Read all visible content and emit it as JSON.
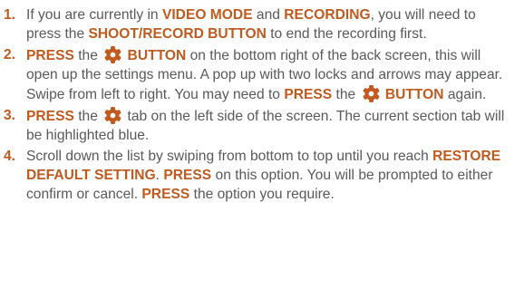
{
  "instructions": [
    {
      "number": "1.",
      "parts": [
        {
          "t": "If you are currently in ",
          "b": false
        },
        {
          "t": "VIDEO MODE",
          "b": true
        },
        {
          "t": " and ",
          "b": false
        },
        {
          "t": "RECORDING",
          "b": true
        },
        {
          "t": ", you will need to press the ",
          "b": false
        },
        {
          "t": "SHOOT/RECORD BUTTON",
          "b": true
        },
        {
          "t": " to end the recording first.",
          "b": false
        }
      ]
    },
    {
      "number": "2.",
      "parts": [
        {
          "t": "PRESS",
          "b": true
        },
        {
          "t": " the ",
          "b": false
        },
        {
          "icon": "gear-icon"
        },
        {
          "t": " BUTTON",
          "b": true
        },
        {
          "t": " on the bottom right of the back screen, this will open up the settings menu. A pop up with two locks and arrows may appear. Swipe from left to right. You may need to ",
          "b": false
        },
        {
          "t": "PRESS",
          "b": true
        },
        {
          "t": " the ",
          "b": false
        },
        {
          "icon": "gear-icon"
        },
        {
          "t": " BUTTON",
          "b": true
        },
        {
          "t": " again.",
          "b": false
        }
      ]
    },
    {
      "number": "3.",
      "parts": [
        {
          "t": "PRESS",
          "b": true
        },
        {
          "t": " the ",
          "b": false
        },
        {
          "icon": "gear-icon"
        },
        {
          "t": " tab on the left side of the screen. The current section tab will be highlighted blue.",
          "b": false
        }
      ]
    },
    {
      "number": "4.",
      "parts": [
        {
          "t": "Scroll down the list by swiping from bottom to top until you reach ",
          "b": false
        },
        {
          "t": "RESTORE DEFAULT SETTING",
          "b": true
        },
        {
          "t": ". ",
          "b": false
        },
        {
          "t": "PRESS",
          "b": true
        },
        {
          "t": " on this option. You will be prompted to either confirm or cancel. ",
          "b": false
        },
        {
          "t": "PRESS",
          "b": true
        },
        {
          "t": " the option you require.",
          "b": false
        }
      ]
    }
  ],
  "colors": {
    "body_text": "#58595b",
    "highlight": "#c05a1e"
  }
}
